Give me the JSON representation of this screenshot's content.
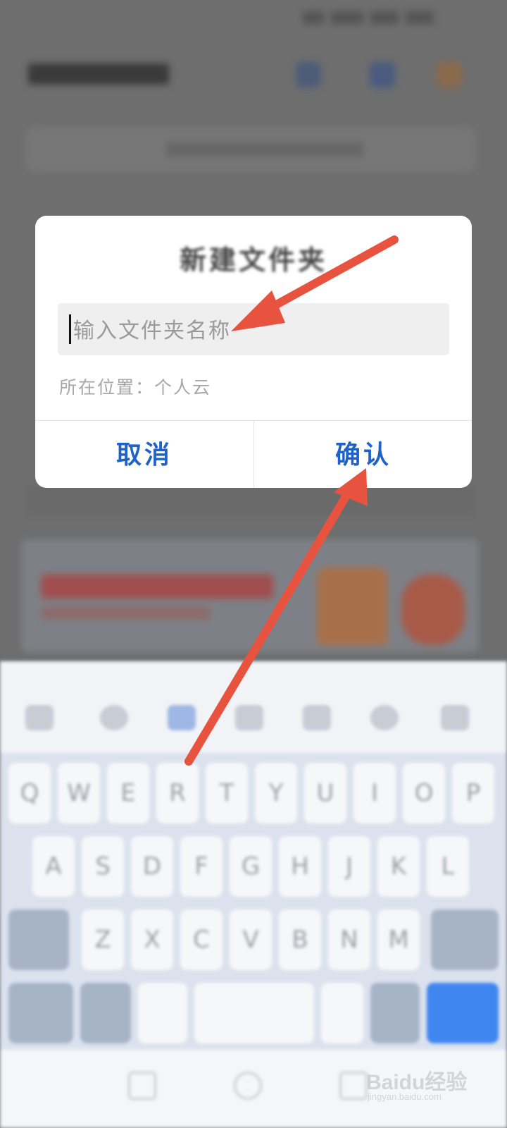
{
  "dialog": {
    "title": "新建文件夹",
    "input_placeholder": "输入文件夹名称",
    "location": "所在位置：个人云",
    "cancel_label": "取消",
    "confirm_label": "确认"
  },
  "keyboard": {
    "row1": [
      "Q",
      "W",
      "E",
      "R",
      "T",
      "Y",
      "U",
      "I",
      "O",
      "P"
    ],
    "row2": [
      "A",
      "S",
      "D",
      "F",
      "G",
      "H",
      "J",
      "K",
      "L"
    ],
    "row3": [
      "Z",
      "X",
      "C",
      "V",
      "B",
      "N",
      "M"
    ]
  },
  "colors": {
    "accent": "#1f63c8",
    "arrow": "#e8533f",
    "enter_key": "#3f86f0"
  },
  "watermark": {
    "brand": "Baidu经验",
    "url": "jingyan.baidu.com"
  }
}
